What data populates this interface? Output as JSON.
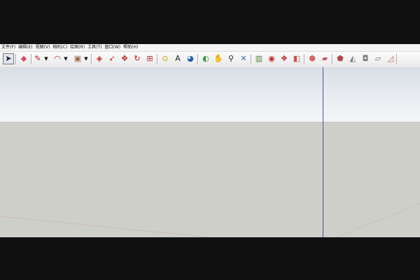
{
  "menu": [
    "文件(F)",
    "编辑(E)",
    "视图(V)",
    "相机(C)",
    "绘图(R)",
    "工具(T)",
    "窗口(W)",
    "帮助(H)"
  ],
  "toolbar": {
    "tools": [
      {
        "name": "select-tool-icon",
        "glyph": "➤",
        "color": "#111111",
        "active": true
      },
      {
        "name": "eraser-tool-icon",
        "glyph": "◆",
        "color": "#d84b6a"
      },
      {
        "name": "pencil-tool-icon",
        "glyph": "✎",
        "color": "#c01818"
      },
      {
        "name": "arc-tool-icon",
        "glyph": "◠",
        "color": "#c01818"
      },
      {
        "name": "rectangle-tool-icon",
        "glyph": "▣",
        "color": "#9c6a4a"
      },
      {
        "name": "push-pull-tool-icon",
        "glyph": "◈",
        "color": "#c02a2a"
      },
      {
        "name": "follow-me-tool-icon",
        "glyph": "➶",
        "color": "#c02a2a"
      },
      {
        "name": "move-tool-icon",
        "glyph": "✥",
        "color": "#c01818"
      },
      {
        "name": "rotate-tool-icon",
        "glyph": "↻",
        "color": "#c01818"
      },
      {
        "name": "scale-tool-icon",
        "glyph": "⊞",
        "color": "#b03030"
      },
      {
        "name": "tape-measure-icon",
        "glyph": "⊙",
        "color": "#c9a100"
      },
      {
        "name": "text-tool-icon",
        "glyph": "A",
        "color": "#222222"
      },
      {
        "name": "paint-bucket-icon",
        "glyph": "◕",
        "color": "#2a5fae"
      },
      {
        "name": "orbit-tool-icon",
        "glyph": "◐",
        "color": "#3a9a3a"
      },
      {
        "name": "pan-tool-icon",
        "glyph": "✋",
        "color": "#444444"
      },
      {
        "name": "zoom-tool-icon",
        "glyph": "⚲",
        "color": "#2a2a2a"
      },
      {
        "name": "zoom-extents-icon",
        "glyph": "✕",
        "color": "#2a6ac2"
      },
      {
        "name": "components-icon",
        "glyph": "▥",
        "color": "#4f7f3a"
      },
      {
        "name": "materials-icon",
        "glyph": "◉",
        "color": "#c02a2a"
      },
      {
        "name": "3d-warehouse-icon",
        "glyph": "❖",
        "color": "#c02a2a"
      },
      {
        "name": "share-model-icon",
        "glyph": "◧",
        "color": "#d05050"
      },
      {
        "name": "iso-view-icon",
        "glyph": "⬢",
        "color": "#d06a6a"
      },
      {
        "name": "top-view-icon",
        "glyph": "▰",
        "color": "#c06464"
      },
      {
        "name": "front-view-icon",
        "glyph": "⬟",
        "color": "#b04848"
      },
      {
        "name": "right-view-icon",
        "glyph": "◭",
        "color": "#7a7a7a"
      },
      {
        "name": "back-view-icon",
        "glyph": "◘",
        "color": "#7a7a7a"
      },
      {
        "name": "left-view-icon",
        "glyph": "▱",
        "color": "#8a6a5a"
      },
      {
        "name": "bottom-view-icon",
        "glyph": "◿",
        "color": "#c06464"
      }
    ]
  },
  "colors": {
    "sky_top": "#d8dee5",
    "ground": "#cfcfca",
    "blue_axis": "#4d4d9a"
  }
}
